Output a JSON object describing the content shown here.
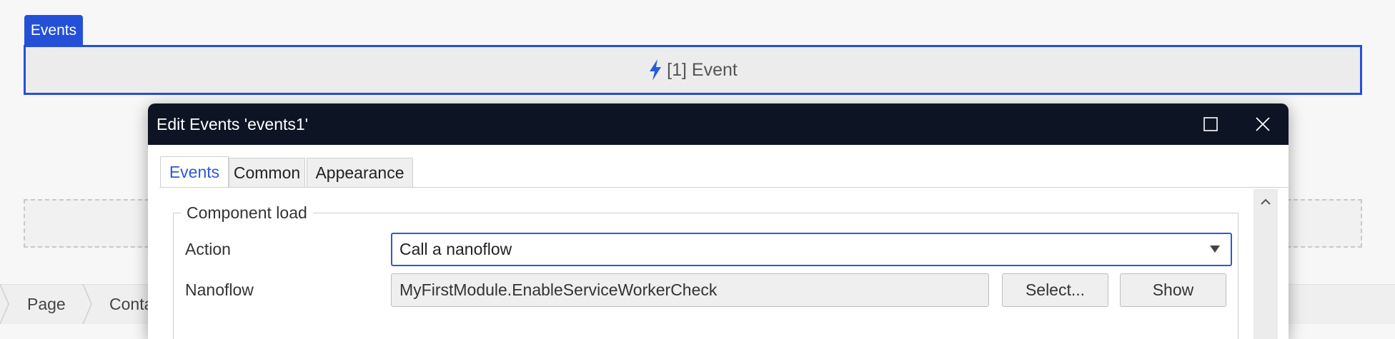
{
  "canvas": {
    "events_tag": "Events",
    "event_widget_label": "[1] Event",
    "icons": {
      "event": "bolt-icon"
    }
  },
  "breadcrumb": {
    "items": [
      "Page",
      "Conta"
    ]
  },
  "dialog": {
    "title": "Edit Events 'events1'",
    "tabs": [
      "Events",
      "Common",
      "Appearance"
    ],
    "active_tab": "Events",
    "group_title": "Component load",
    "action": {
      "label": "Action",
      "value": "Call a nanoflow"
    },
    "nanoflow": {
      "label": "Nanoflow",
      "value": "MyFirstModule.EnableServiceWorkerCheck",
      "select_button": "Select...",
      "show_button": "Show"
    }
  },
  "colors": {
    "accent": "#2450d8",
    "titlebar": "#0d1424",
    "tab_active_text": "#2a5bd7"
  }
}
